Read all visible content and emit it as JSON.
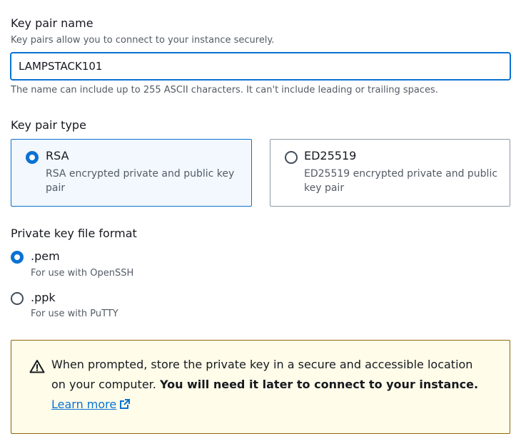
{
  "key_pair_name": {
    "label": "Key pair name",
    "description": "Key pairs allow you to connect to your instance securely.",
    "value": "LAMPSTACK101",
    "constraint": "The name can include up to 255 ASCII characters. It can't include leading or trailing spaces."
  },
  "key_pair_type": {
    "label": "Key pair type",
    "options": [
      {
        "title": "RSA",
        "description": "RSA encrypted private and public key pair",
        "selected": true
      },
      {
        "title": "ED25519",
        "description": "ED25519 encrypted private and public key pair",
        "selected": false
      }
    ]
  },
  "private_key_format": {
    "label": "Private key file format",
    "options": [
      {
        "title": ".pem",
        "description": "For use with OpenSSH",
        "selected": true
      },
      {
        "title": ".ppk",
        "description": "For use with PuTTY",
        "selected": false
      }
    ]
  },
  "alert": {
    "text": "When prompted, store the private key in a secure and accessible location on your computer.",
    "bold_text": "You will need it later to connect to your instance.",
    "link_text": "Learn more",
    "icon": "warning-icon",
    "link_icon": "external-link-icon"
  },
  "colors": {
    "accent": "#0972d3",
    "warning_border": "#8d6605",
    "warning_bg": "#fffce9",
    "selected_tile_bg": "#f2f8fd"
  }
}
